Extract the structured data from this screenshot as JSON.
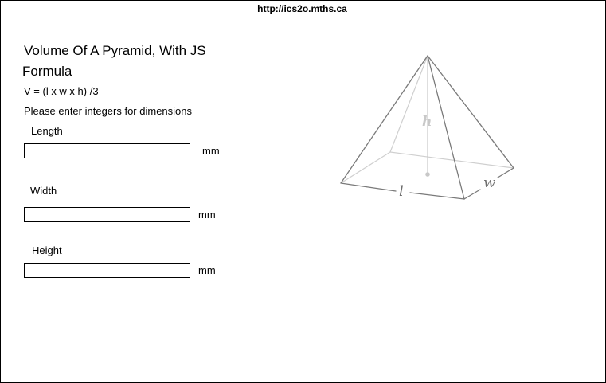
{
  "address_bar": {
    "url": "http://ics2o.mths.ca"
  },
  "page": {
    "title_line1": "Volume Of A Pyramid, With JS",
    "title_line2": "Formula",
    "formula": "V = (l x w x h) /3",
    "instructions": "Please enter integers for dimensions"
  },
  "form": {
    "length": {
      "label": "Length",
      "value": "",
      "unit": "mm"
    },
    "width": {
      "label": "Width",
      "value": "",
      "unit": "mm"
    },
    "height": {
      "label": "Height",
      "value": "",
      "unit": "mm"
    }
  },
  "diagram": {
    "label_h": "h",
    "label_l": "l",
    "label_w": "w"
  }
}
